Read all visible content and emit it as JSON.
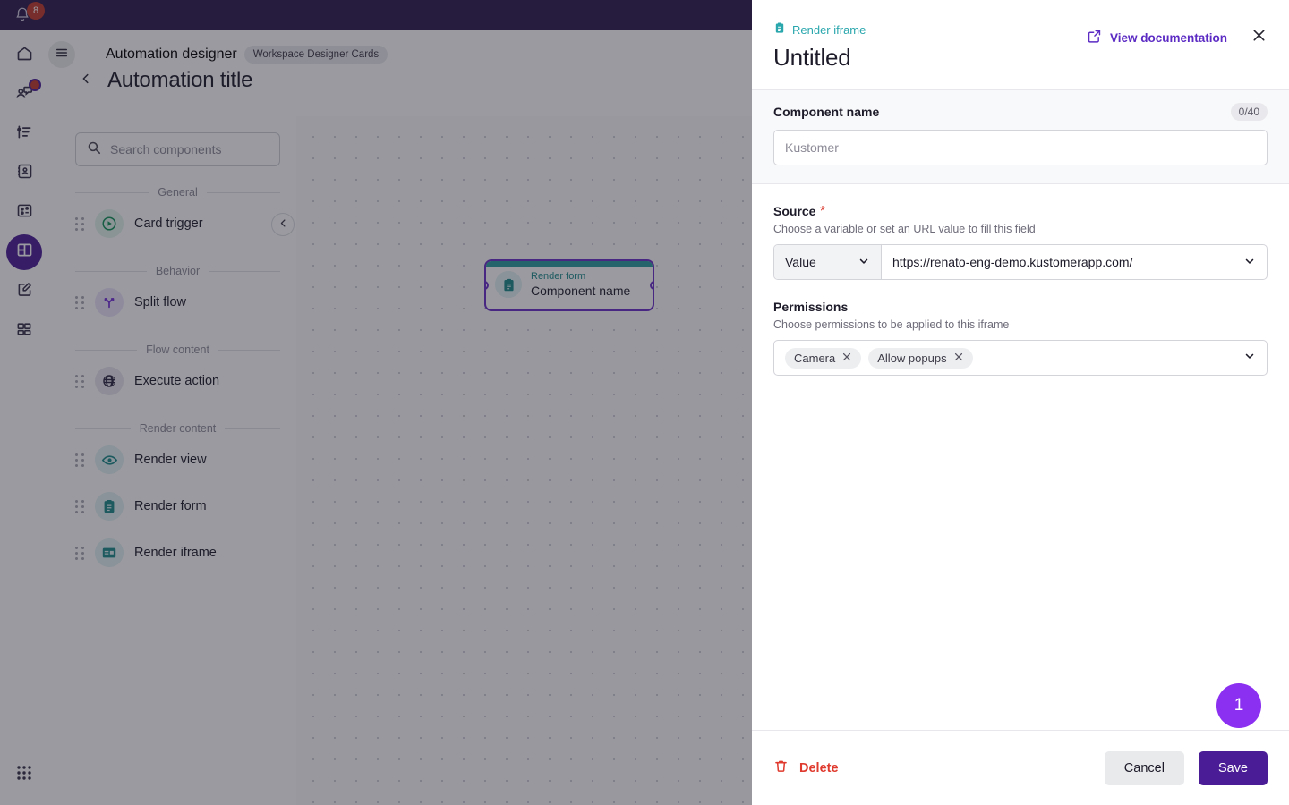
{
  "topbar": {
    "notification_count": "8",
    "bell_icon": "bell-icon"
  },
  "left_rail": {
    "items": [
      {
        "icon": "home-icon",
        "name": "home"
      },
      {
        "icon": "conversations-icon",
        "name": "conversations",
        "badge": true
      },
      {
        "icon": "insights-list-icon",
        "name": "insights"
      },
      {
        "icon": "contacts-card-icon",
        "name": "contacts"
      },
      {
        "icon": "reports-icon",
        "name": "reports"
      },
      {
        "icon": "workspace-layout-icon",
        "name": "workspaces",
        "active": true
      },
      {
        "icon": "compose-edit-icon",
        "name": "compose"
      },
      {
        "icon": "grid-four-icon",
        "name": "apps"
      }
    ],
    "bottom": {
      "icon": "app-grid-icon",
      "name": "app-launcher"
    }
  },
  "page": {
    "hamburger_icon": "hamburger-icon",
    "back_icon": "chevron-left-icon",
    "breadcrumb": "Automation designer",
    "breadcrumb_chip": "Workspace Designer Cards",
    "title": "Automation title"
  },
  "components_panel": {
    "search": {
      "placeholder": "Search components",
      "icon": "search-icon"
    },
    "collapse_icon": "chevron-left-icon",
    "groups": [
      {
        "label": "General",
        "items": [
          {
            "label": "Card trigger",
            "icon": "play-circle-icon",
            "tone": "green"
          }
        ]
      },
      {
        "label": "Behavior",
        "items": [
          {
            "label": "Split flow",
            "icon": "split-branch-icon",
            "tone": "purple"
          }
        ]
      },
      {
        "label": "Flow content",
        "items": [
          {
            "label": "Execute action",
            "icon": "globe-icon",
            "tone": "dark"
          }
        ]
      },
      {
        "label": "Render content",
        "items": [
          {
            "label": "Render view",
            "icon": "eye-icon",
            "tone": "teal"
          },
          {
            "label": "Render form",
            "icon": "clipboard-icon",
            "tone": "teal"
          },
          {
            "label": "Render iframe",
            "icon": "iframe-window-icon",
            "tone": "teal"
          }
        ]
      }
    ]
  },
  "canvas": {
    "node": {
      "kind": "Render form",
      "title": "Component name",
      "icon": "clipboard-icon",
      "accent_color": "#2a9d9d",
      "border_color": "#6b2fc9"
    }
  },
  "drawer": {
    "kind_icon": "clipboard-icon",
    "kind": "Render iframe",
    "title": "Untitled",
    "doc_link": {
      "label": "View documentation",
      "icon": "external-link-icon"
    },
    "close_icon": "close-icon",
    "component_name": {
      "label": "Component name",
      "counter": "0/40",
      "value": "",
      "placeholder": "Kustomer"
    },
    "source": {
      "label": "Source",
      "required_marker": "*",
      "help": "Choose a variable or set an URL value to fill this field",
      "mode": "Value",
      "value": "https://renato-eng-demo.kustomerapp.com/",
      "caret_icon": "chevron-down-icon"
    },
    "permissions": {
      "label": "Permissions",
      "help": "Choose permissions to be applied to this iframe",
      "tags": [
        "Camera",
        "Allow popups"
      ],
      "remove_icon": "close-icon",
      "caret_icon": "chevron-down-icon"
    },
    "float_badge": "1",
    "footer": {
      "delete_label": "Delete",
      "delete_icon": "trash-icon",
      "cancel_label": "Cancel",
      "save_label": "Save"
    }
  },
  "colors": {
    "brand_purple": "#4a1d96",
    "accent_teal": "#2aa7ad",
    "danger_red": "#e03b2f",
    "badge_purple": "#8b2ff0"
  }
}
